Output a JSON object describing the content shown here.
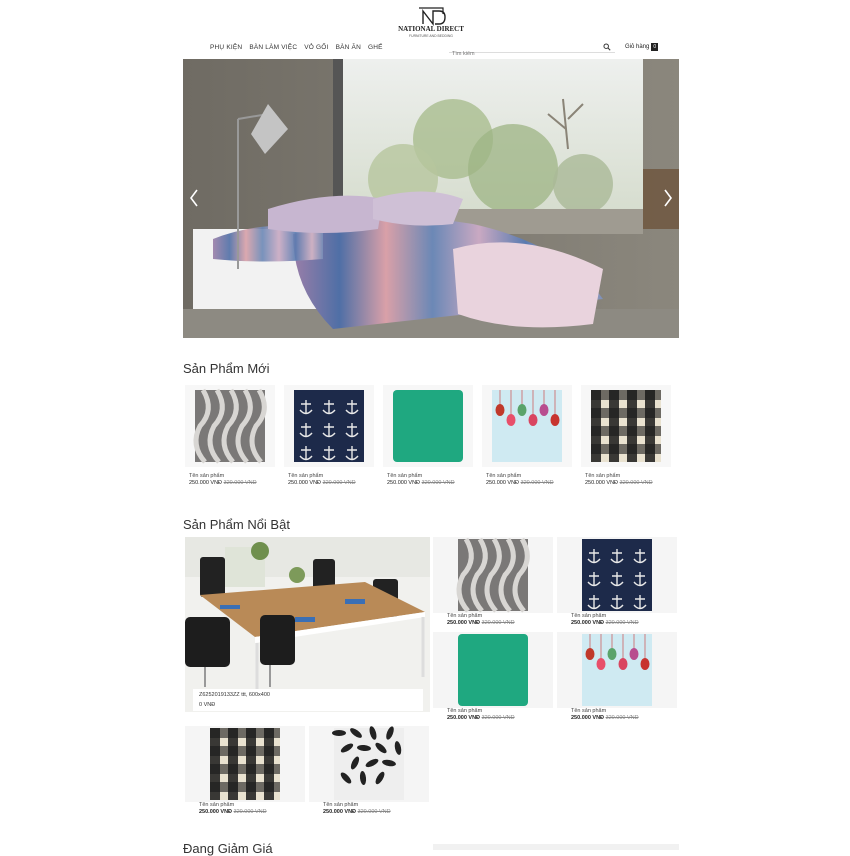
{
  "brand": {
    "name": "NATIONAL DIRECT",
    "tagline": "FURNITURE AND BEDDING"
  },
  "nav": {
    "items": [
      "PHỤ KIỆN",
      "BÀN LÀM VIỆC",
      "VỎ GỐI",
      "BÀN ĂN",
      "GHẾ"
    ]
  },
  "search": {
    "placeholder": "Tìm kiếm",
    "icon": "search-icon"
  },
  "cart": {
    "label": "Giỏ hàng",
    "count": "0"
  },
  "hero": {
    "prev_icon": "chevron-left-icon",
    "next_icon": "chevron-right-icon"
  },
  "new_products": {
    "title": "Sản Phẩm Mới",
    "items": [
      {
        "name": "Tên sản phẩm",
        "price": "250.000 VNĐ",
        "old_price": "320.000 VNĐ",
        "pattern": "zebra"
      },
      {
        "name": "Tên sản phẩm",
        "price": "250.000 VNĐ",
        "old_price": "320.000 VNĐ",
        "pattern": "anchor"
      },
      {
        "name": "Tên sản phẩm",
        "price": "250.000 VNĐ",
        "old_price": "320.000 VNĐ",
        "pattern": "green"
      },
      {
        "name": "Tên sản phẩm",
        "price": "250.000 VNĐ",
        "old_price": "320.000 VNĐ",
        "pattern": "ornament"
      },
      {
        "name": "Tên sản phẩm",
        "price": "250.000 VNĐ",
        "old_price": "320.000 VNĐ",
        "pattern": "plaid"
      }
    ]
  },
  "featured": {
    "title": "Sản Phẩm Nổi Bật",
    "big": {
      "name": "Z6252019133ZZ ttt, 600x400",
      "price": "0 VNĐ"
    },
    "items": [
      {
        "name": "Tên sản phẩm",
        "price": "250.000 VNĐ",
        "old_price": "320.000 VNĐ",
        "pattern": "zebra"
      },
      {
        "name": "Tên sản phẩm",
        "price": "250.000 VNĐ",
        "old_price": "320.000 VNĐ",
        "pattern": "anchor"
      },
      {
        "name": "Tên sản phẩm",
        "price": "250.000 VNĐ",
        "old_price": "320.000 VNĐ",
        "pattern": "green"
      },
      {
        "name": "Tên sản phẩm",
        "price": "250.000 VNĐ",
        "old_price": "320.000 VNĐ",
        "pattern": "ornament"
      },
      {
        "name": "Tên sản phẩm",
        "price": "250.000 VNĐ",
        "old_price": "320.000 VNĐ",
        "pattern": "plaid"
      },
      {
        "name": "Tên sản phẩm",
        "price": "250.000 VNĐ",
        "old_price": "320.000 VNĐ",
        "pattern": "floral"
      }
    ]
  },
  "sale": {
    "title": "Đang Giảm Giá"
  },
  "colors": {
    "green": "#1fa880",
    "navy": "#1d2a4a",
    "accent": "#222222"
  }
}
